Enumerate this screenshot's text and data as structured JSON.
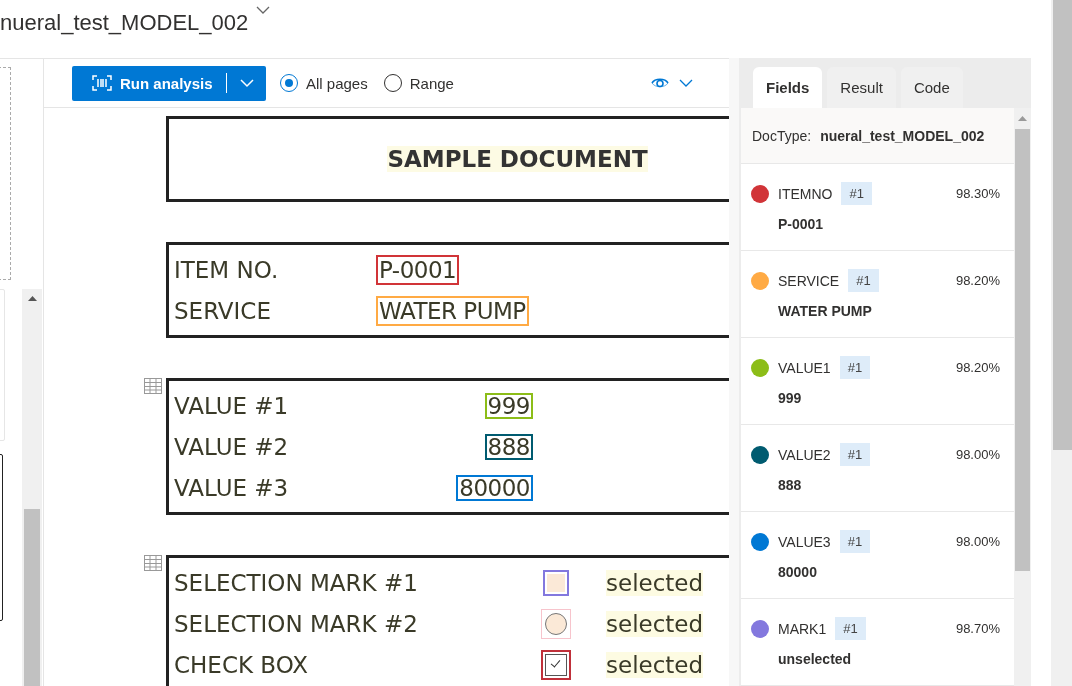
{
  "header": {
    "title": "nueral_test_MODEL_002"
  },
  "toolbar": {
    "run_button": "Run analysis",
    "page_options": [
      {
        "label": "All pages",
        "selected": true
      },
      {
        "label": "Range",
        "selected": false
      }
    ]
  },
  "document": {
    "title": "SAMPLE DOCUMENT",
    "sections": [
      {
        "kind": "fields",
        "table_icon": false,
        "rows": [
          {
            "kind": "text",
            "label": "ITEM NO.",
            "value": "P-0001",
            "color": "#d13438"
          },
          {
            "kind": "text",
            "label": "SERVICE",
            "value": "WATER PUMP",
            "color": "#ffaa44"
          }
        ]
      },
      {
        "kind": "values",
        "table_icon": true,
        "rows": [
          {
            "kind": "text",
            "label": "VALUE #1",
            "value": "999",
            "color": "#8cbd18"
          },
          {
            "kind": "text",
            "label": "VALUE #2",
            "value": "888",
            "color": "#005b70"
          },
          {
            "kind": "text",
            "label": "VALUE #3",
            "value": "80000",
            "color": "#0078d4"
          }
        ]
      },
      {
        "kind": "marks",
        "table_icon": true,
        "rows": [
          {
            "kind": "square",
            "label": "SELECTION MARK #1",
            "value": "selected",
            "color": "#8378de",
            "checked": false
          },
          {
            "kind": "circle",
            "label": "SELECTION MARK #2",
            "value": "selected",
            "color": "#f7c4cc",
            "checked": false
          },
          {
            "kind": "checkbox",
            "label": "CHECK BOX",
            "value": "selected",
            "color": "#c0303a",
            "checked": true
          }
        ]
      }
    ]
  },
  "panel": {
    "tabs": [
      {
        "label": "Fields",
        "selected": true
      },
      {
        "label": "Result",
        "selected": false
      },
      {
        "label": "Code",
        "selected": false
      }
    ],
    "doctype_label": "DocType:",
    "doctype": "nueral_test_MODEL_002",
    "fields": [
      {
        "name": "ITEMNO",
        "badge": "#1",
        "confidence": "98.30%",
        "value": "P-0001",
        "color": "#d13438"
      },
      {
        "name": "SERVICE",
        "badge": "#1",
        "confidence": "98.20%",
        "value": "WATER PUMP",
        "color": "#ffaa44"
      },
      {
        "name": "VALUE1",
        "badge": "#1",
        "confidence": "98.20%",
        "value": "999",
        "color": "#8cbd18"
      },
      {
        "name": "VALUE2",
        "badge": "#1",
        "confidence": "98.00%",
        "value": "888",
        "color": "#005b70"
      },
      {
        "name": "VALUE3",
        "badge": "#1",
        "confidence": "98.00%",
        "value": "80000",
        "color": "#0078d4"
      },
      {
        "name": "MARK1",
        "badge": "#1",
        "confidence": "98.70%",
        "value": "unselected",
        "color": "#8378de"
      }
    ]
  }
}
